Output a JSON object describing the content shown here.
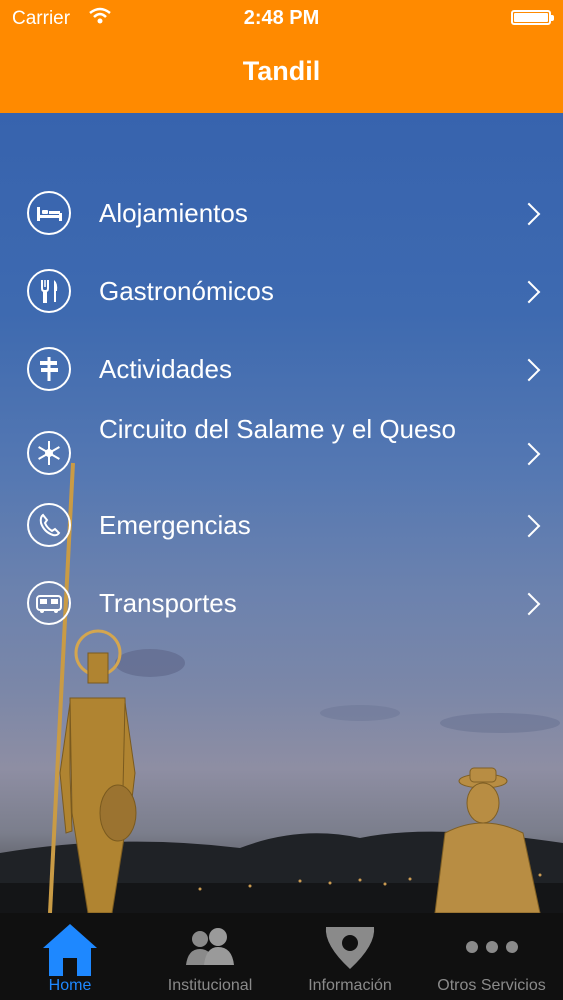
{
  "status_bar": {
    "carrier": "Carrier",
    "time": "2:48 PM"
  },
  "header": {
    "title": "Tandil",
    "color": "#ff8a00"
  },
  "menu": {
    "items": [
      {
        "label": "Alojamientos",
        "icon": "bed-icon"
      },
      {
        "label": "Gastronómicos",
        "icon": "fork-knife-icon"
      },
      {
        "label": "Actividades",
        "icon": "signpost-icon"
      },
      {
        "label": "Circuito del Salame y el Queso",
        "icon": "snowflake-icon"
      },
      {
        "label": "Emergencias",
        "icon": "phone-icon"
      },
      {
        "label": "Transportes",
        "icon": "bus-icon"
      }
    ]
  },
  "tabbar": {
    "tabs": [
      {
        "label": "Home",
        "icon": "home-icon",
        "active": true
      },
      {
        "label": "Institucional",
        "icon": "people-icon",
        "active": false
      },
      {
        "label": "Información",
        "icon": "info-shield-icon",
        "active": false
      },
      {
        "label": "Otros Servicios",
        "icon": "more-icon",
        "active": false
      }
    ],
    "active_color": "#1e88ff"
  }
}
